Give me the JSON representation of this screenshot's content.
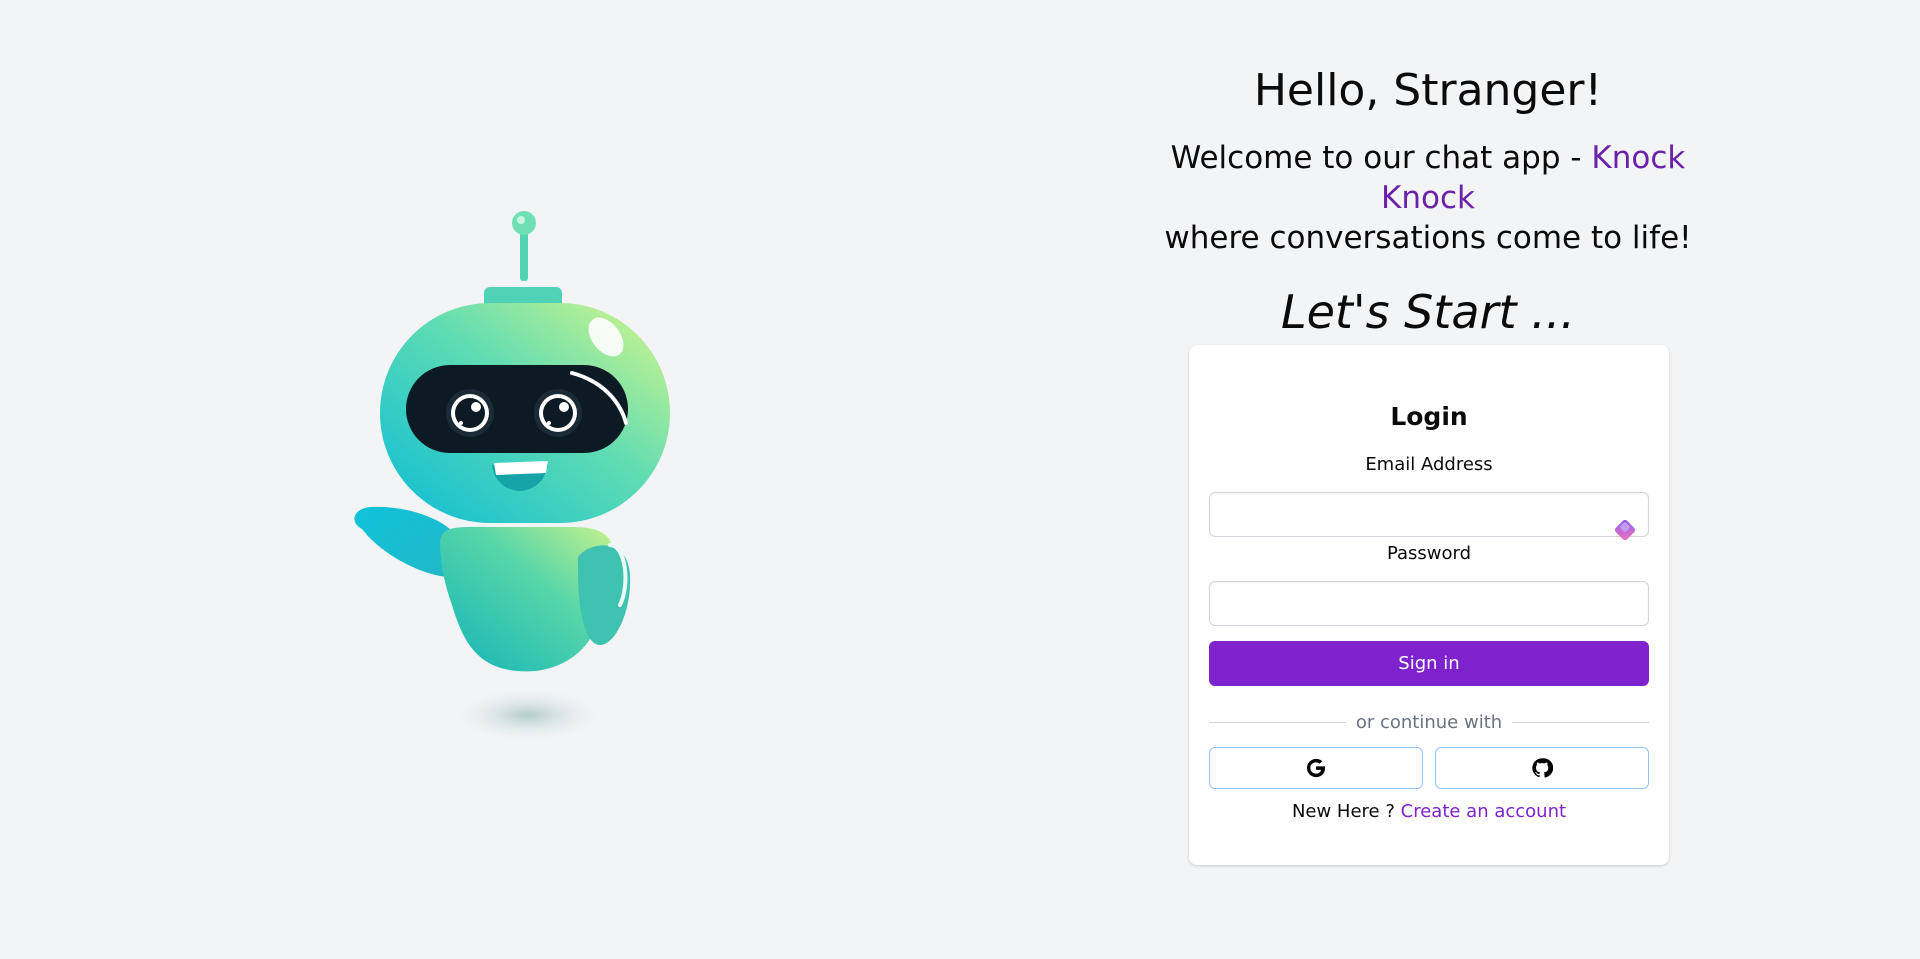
{
  "hero": {
    "greeting": "Hello, Stranger!",
    "welcome_prefix": "Welcome to our chat app - ",
    "brand_name": "Knock Knock",
    "welcome_suffix": "where conversations come to life!",
    "tagline": "Let's Start ..."
  },
  "login_card": {
    "title": "Login",
    "email_label": "Email Address",
    "email_value": "",
    "password_label": "Password",
    "password_value": "",
    "signin_label": "Sign in",
    "divider_text": "or continue with",
    "social": [
      {
        "icon": "google-icon"
      },
      {
        "icon": "github-icon"
      }
    ],
    "signup_prompt": "New Here ?",
    "signup_link": "Create an account"
  },
  "colors": {
    "background": "#f3f4f6",
    "accent": "#7e22ce",
    "brand_text": "#6b21a8",
    "social_border": "#93c5fd"
  }
}
